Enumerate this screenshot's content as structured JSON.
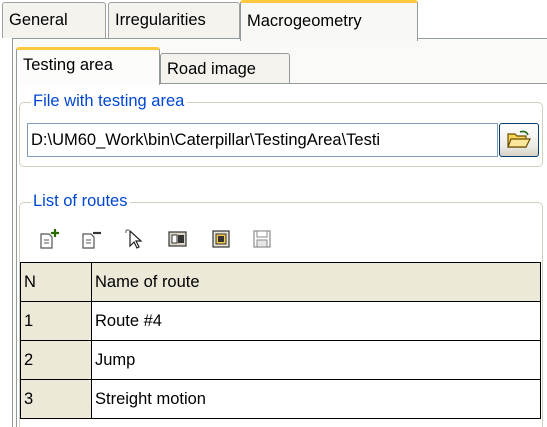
{
  "tabs": {
    "general": "General",
    "irregularities": "Irregularities",
    "macrogeometry": "Macrogeometry"
  },
  "subtabs": {
    "testing_area": "Testing area",
    "road_image": "Road image"
  },
  "file_group": {
    "legend": "File with testing area",
    "path": "D:\\UM60_Work\\bin\\Caterpillar\\TestingArea\\Testi",
    "browse_icon": "open-folder-icon"
  },
  "routes_group": {
    "legend": "List of routes",
    "toolbar": [
      {
        "name": "add-route-icon"
      },
      {
        "name": "delete-route-icon"
      },
      {
        "name": "select-route-icon"
      },
      {
        "name": "route-properties-icon"
      },
      {
        "name": "load-route-icon"
      },
      {
        "name": "save-route-icon"
      }
    ],
    "table": {
      "headers": [
        "N",
        "Name of route"
      ],
      "rows": [
        [
          "1",
          "Route #4"
        ],
        [
          "2",
          "Jump"
        ],
        [
          "3",
          "Streight motion"
        ]
      ]
    }
  },
  "colors": {
    "accent_tab": "#ffc83d",
    "legend_text": "#0046d5",
    "header_bg": "#ece9d8"
  }
}
